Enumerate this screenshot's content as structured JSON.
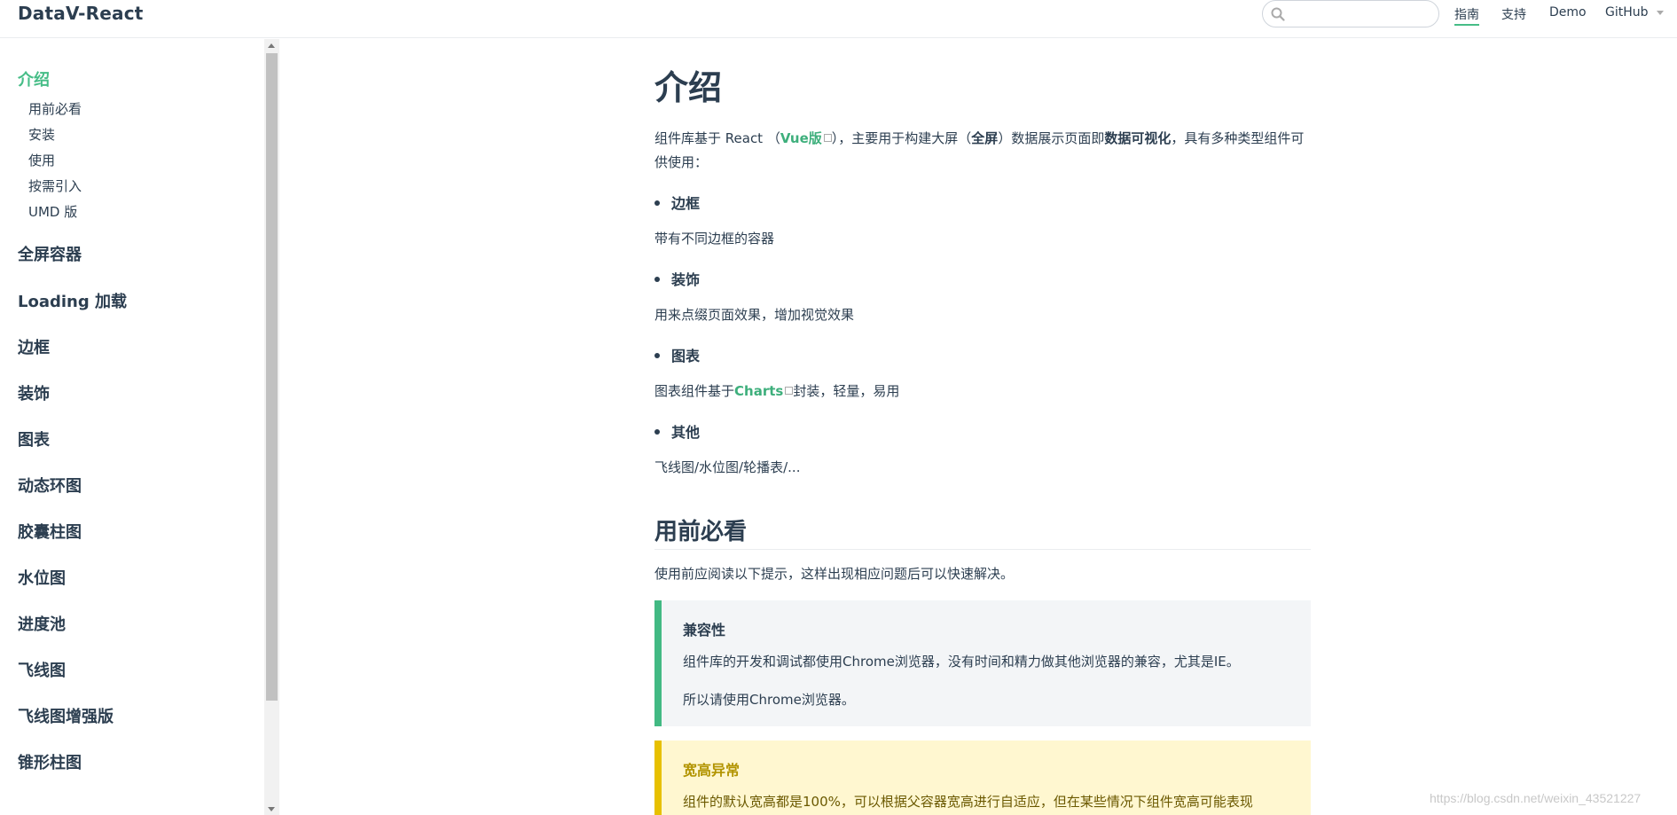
{
  "header": {
    "site_title": "DataV-React",
    "search": {
      "value": "",
      "placeholder": ""
    },
    "nav": [
      {
        "label": "指南",
        "active": true
      },
      {
        "label": "支持"
      },
      {
        "label": "Demo"
      },
      {
        "label": "GitHub"
      }
    ]
  },
  "sidebar": {
    "active_title": "介绍",
    "sub_items": [
      "用前必看",
      "安装",
      "使用",
      "按需引入",
      "UMD 版"
    ],
    "groups": [
      "全屏容器",
      "Loading 加载",
      "边框",
      "装饰",
      "图表",
      "动态环图",
      "胶囊柱图",
      "水位图",
      "进度池",
      "飞线图",
      "飞线图增强版",
      "锥形柱图"
    ]
  },
  "content": {
    "title": "介绍",
    "intro_prefix": "组件库基于 React （",
    "vue_link": "Vue版",
    "intro_mid": "），主要用于构建大屏（",
    "fullscreen": "全屏",
    "intro_mid2": "）数据展示页面即",
    "dataviz": "数据可视化",
    "intro_suffix": "，具有多种类型组件可供使用：",
    "bullets": [
      {
        "label": "边框",
        "desc": "带有不同边框的容器"
      },
      {
        "label": "装饰",
        "desc": "用来点缀页面效果，增加视觉效果"
      },
      {
        "label": "图表",
        "desc_prefix": "图表组件基于",
        "desc_link": "Charts",
        "desc_suffix": "封装，轻量，易用"
      },
      {
        "label": "其他",
        "desc": "飞线图/水位图/轮播表/..."
      }
    ],
    "section_title": "用前必看",
    "section_desc": "使用前应阅读以下提示，这样出现相应问题后可以快速解决。",
    "tip": {
      "title": "兼容性",
      "line1": "组件库的开发和调试都使用Chrome浏览器，没有时间和精力做其他浏览器的兼容，尤其是IE。",
      "line2": "所以请使用Chrome浏览器。"
    },
    "warning": {
      "title": "宽高异常",
      "line1": "组件的默认宽高都是100%，可以根据父容器宽高进行自适应，但在某些情况下组件宽高可能表现"
    }
  },
  "watermark": "https://blog.csdn.net/weixin_43521227",
  "colors": {
    "accent": "#3eaf7c",
    "text": "#2c3e50",
    "tip_border": "#42b983",
    "warn_border": "#e7c000"
  }
}
